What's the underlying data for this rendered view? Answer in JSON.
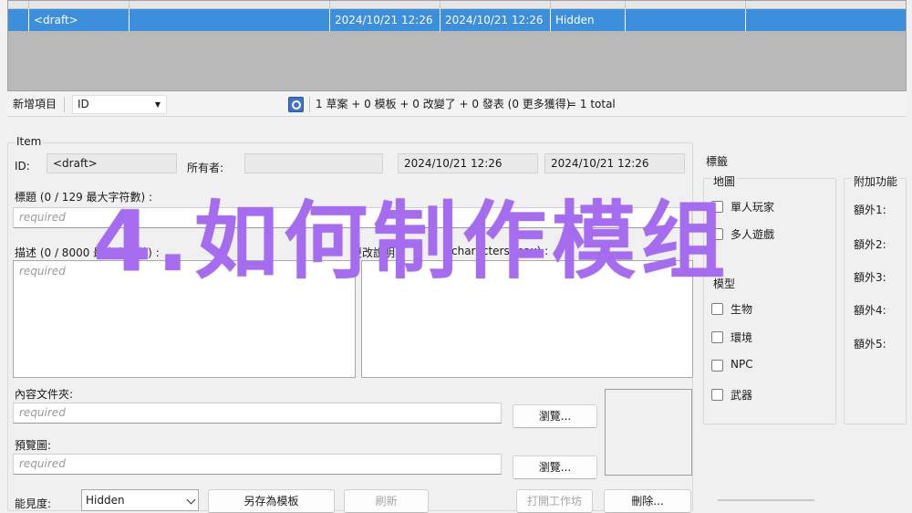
{
  "list": {
    "row": {
      "name": "<draft>",
      "title": "",
      "created": "2024/10/21 12:26",
      "updated": "2024/10/21 12:26",
      "visibility": "Hidden",
      "extra": ""
    }
  },
  "toolbar": {
    "add_item": "新增項目",
    "id_field": "ID",
    "status_summary": "1 草案 + 0 模板 + 0 改變了 + 0 發表 (0 更多獲得)",
    "total": "= 1 total"
  },
  "item": {
    "legend": "Item",
    "id_label": "ID:",
    "id_value": "<draft>",
    "owner_label": "所有者:",
    "owner_value": "",
    "created_value": "2024/10/21 12:26",
    "updated_value": "2024/10/21 12:26",
    "title_label": "標題 (0 / 129 最大字符數) :",
    "title_placeholder": "required",
    "desc_label": "描述 (0 / 8000 最大字符數) :",
    "desc_placeholder": "required",
    "change_label": "更改說明",
    "change_label_tail": "characters max) :",
    "content_label": "內容文件夾:",
    "content_placeholder": "required",
    "browse_label": "瀏覽...",
    "preview_label": "預覽圖:",
    "preview_placeholder": "required",
    "visibility_label": "能見度:",
    "visibility_value": "Hidden",
    "save_template": "另存為模板",
    "refresh": "刷新",
    "open_workshop": "打開工作坊",
    "delete": "刪除..."
  },
  "tags": {
    "legend": "標籤",
    "map_group": "地圖",
    "map_items": [
      "單人玩家",
      "多人遊戲"
    ],
    "model_group": "模型",
    "model_items": [
      "生物",
      "環境",
      "NPC",
      "武器"
    ],
    "extra_group": "附加功能",
    "extra_items": [
      "額外1:",
      "額外2:",
      "額外3:",
      "額外4:",
      "額外5:"
    ]
  },
  "overlay": {
    "title": "4.如何制作模组"
  },
  "colors": {
    "selection": "#3c8fdb",
    "overlay_text": "#a56cf0"
  }
}
